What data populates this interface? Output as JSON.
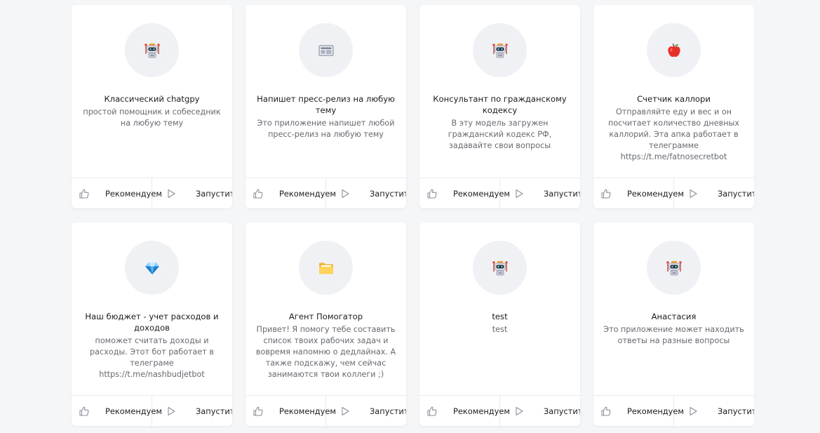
{
  "cards": [
    {
      "icon": "robot-icon",
      "title": "Классический chatgpy",
      "description": "простой помощник и собеседник на любую тему",
      "recommend_label": "Рекомендуем",
      "run_label": "Запустить"
    },
    {
      "icon": "newspaper-icon",
      "title": "Напишет пресс-релиз на любую тему",
      "description": "Это приложение напишет любой пресс-релиз на любую тему",
      "recommend_label": "Рекомендуем",
      "run_label": "Запустить"
    },
    {
      "icon": "robot-icon",
      "title": "Консультант по гражданскому кодексу",
      "description": "В эту модель загружен гражданский кодекс РФ, задавайте свои вопросы",
      "recommend_label": "Рекомендуем",
      "run_label": "Запустить"
    },
    {
      "icon": "apple-icon",
      "title": "Счетчик каллори",
      "description": "Отправляйте еду и вес и он посчитает количество дневных каллорий. Эта апка работает в телеграмме https://t.me/fatnosecretbot",
      "recommend_label": "Рекомендуем",
      "run_label": "Запустить"
    },
    {
      "icon": "diamond-icon",
      "title": "Наш бюджет - учет расходов и доходов",
      "description": "поможет считать доходы и расходы. Этот бот работает в телеграме https://t.me/nashbudjetbot",
      "recommend_label": "Рекомендуем",
      "run_label": "Запустить"
    },
    {
      "icon": "folder-icon",
      "title": "Агент Помогатор",
      "description": "Привет! Я помогу тебе составить список твоих рабочих задач и вовремя напомню о дедлайнах. А также подскажу, чем сейчас занимаются твои коллеги ;)",
      "recommend_label": "Рекомендуем",
      "run_label": "Запустить"
    },
    {
      "icon": "robot-icon",
      "title": "test",
      "description": "test",
      "recommend_label": "Рекомендуем",
      "run_label": "Запустить"
    },
    {
      "icon": "robot-icon",
      "title": "Анастасия",
      "description": "Это приложение может находить ответы на разные вопросы",
      "recommend_label": "Рекомендуем",
      "run_label": "Запустить"
    }
  ]
}
